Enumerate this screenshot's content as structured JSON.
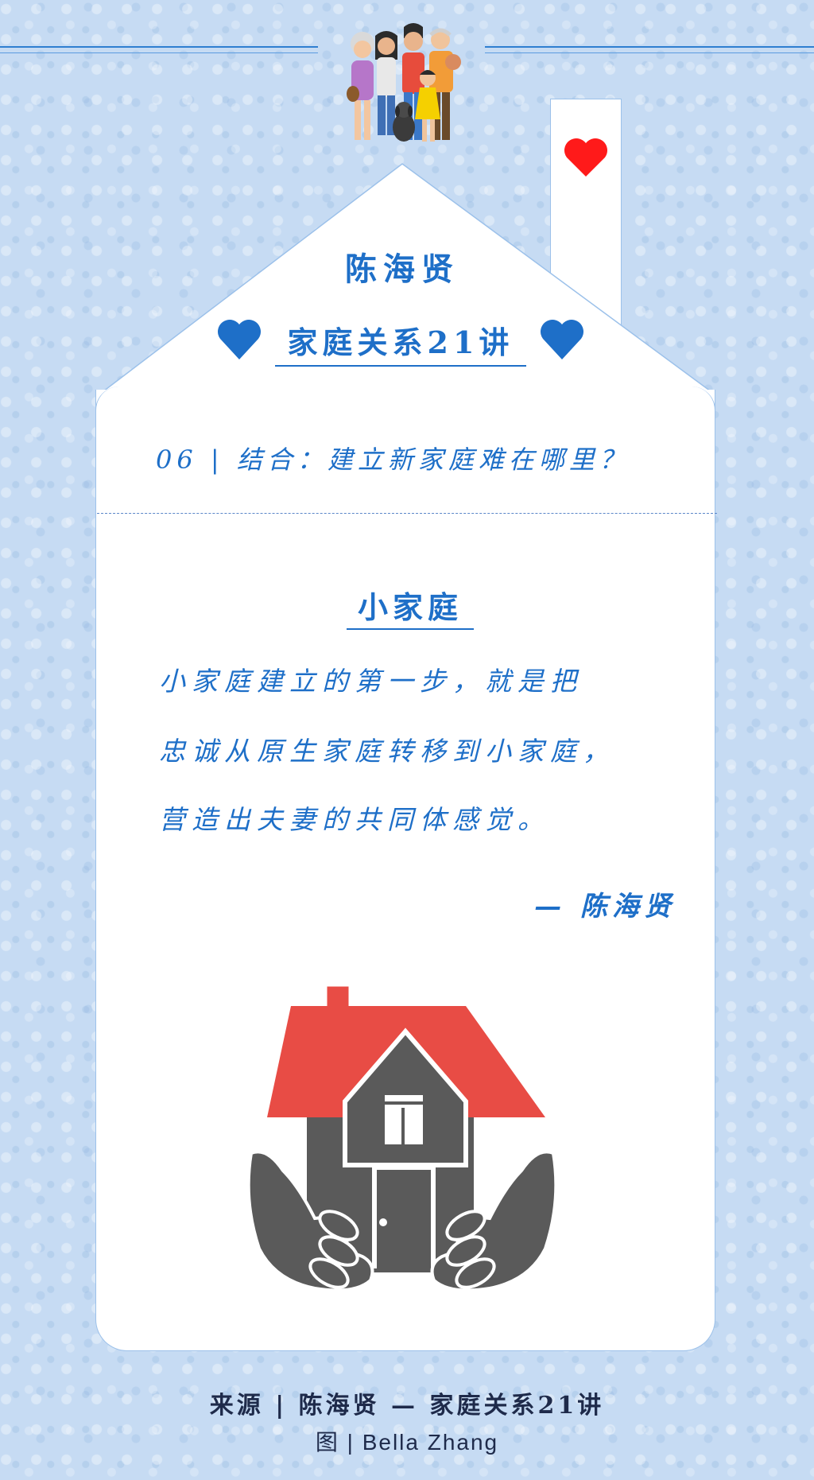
{
  "header": {
    "author": "陈海贤",
    "series_title": "家庭关系21讲"
  },
  "episode": {
    "label": "06 | 结合：建立新家庭难在哪里？"
  },
  "section": {
    "heading": "小家庭",
    "quote_lines": [
      "小家庭建立的第一步，就是把",
      "忠诚从原生家庭转移到小家庭，",
      "营造出夫妻的共同体感觉。"
    ],
    "attribution": "— 陈海贤"
  },
  "footer": {
    "source_line": "来源 | 陈海贤 — 家庭关系21讲",
    "credit_line": "图 | Bella Zhang"
  },
  "colors": {
    "accent_blue": "#1e6fc8",
    "heart_red": "#ff1a1a",
    "roof_red": "#e84c45",
    "house_gray": "#5a5a5a",
    "background": "#c6dbf3"
  },
  "icons": [
    "family-illustration",
    "heart-icon",
    "house-in-hands-icon"
  ]
}
